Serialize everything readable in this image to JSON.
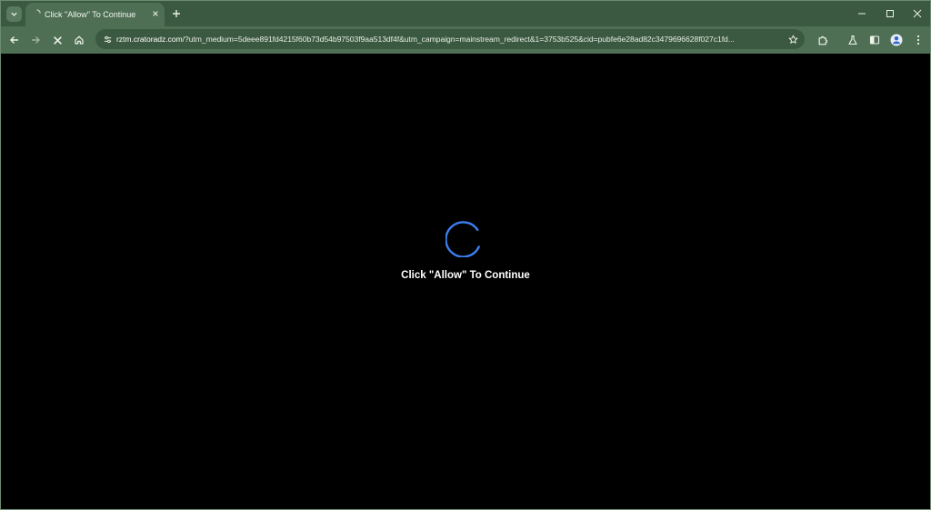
{
  "browser": {
    "tab": {
      "title": "Click \"Allow\" To Continue"
    },
    "address_bar": {
      "host": "rztm.cratoradz.com",
      "path": "/?utm_medium=5deee891fd4215f60b73d54b97503f9aa513df4f&utm_campaign=mainstream_redirect&1=3753b525&cid=pubfe6e28ad82c3479696628f027c1fd..."
    }
  },
  "page": {
    "message": "Click \"Allow\" To Continue"
  },
  "colors": {
    "frame": "#3b5940",
    "toolbar": "#4e6f54",
    "spinner": "#3b7ff0",
    "background": "#000000"
  }
}
